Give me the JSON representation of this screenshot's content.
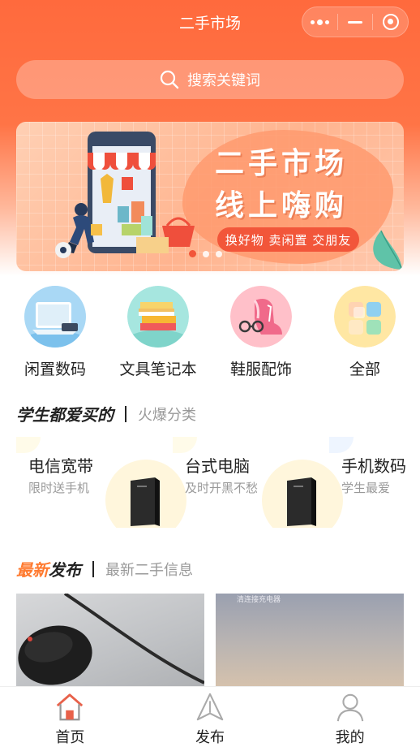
{
  "header": {
    "title": "二手市场"
  },
  "capsule": {
    "more_icon": "more-dots-icon",
    "minimize_icon": "minus-icon",
    "close_icon": "target-icon"
  },
  "search": {
    "placeholder": "搜索关键词",
    "icon": "search-icon"
  },
  "banner": {
    "line1": "二手市场",
    "line2": "线上嗨购",
    "tag": "换好物 卖闲置 交朋友",
    "active_dot": 0,
    "dot_count": 3
  },
  "categories": [
    {
      "label": "闲置数码",
      "icon": "laptop-icon"
    },
    {
      "label": "文具笔记本",
      "icon": "books-icon"
    },
    {
      "label": "鞋服配饰",
      "icon": "shoe-glasses-icon"
    },
    {
      "label": "全部",
      "icon": "grid-icon"
    }
  ],
  "hot_section": {
    "title": "学生都爱买的",
    "subtitle": "火爆分类",
    "items": [
      {
        "title": "电信宽带",
        "subtitle": "限时送手机"
      },
      {
        "title": "台式电脑",
        "subtitle": "及时开黑不愁"
      },
      {
        "title": "手机数码",
        "subtitle": "学生最爱"
      }
    ]
  },
  "latest_section": {
    "title_highlight": "最新",
    "title_rest": "发布",
    "subtitle": "最新二手信息",
    "posts": [
      {
        "caption": ""
      },
      {
        "caption": "清连接充电器"
      }
    ]
  },
  "tabbar": {
    "items": [
      {
        "label": "首页",
        "icon": "home-icon",
        "active": true
      },
      {
        "label": "发布",
        "icon": "publish-icon",
        "active": false
      },
      {
        "label": "我的",
        "icon": "profile-icon",
        "active": false
      }
    ]
  },
  "colors": {
    "brand": "#ff6a3d",
    "accent": "#ff7a2f",
    "tag": "#f2563a"
  }
}
